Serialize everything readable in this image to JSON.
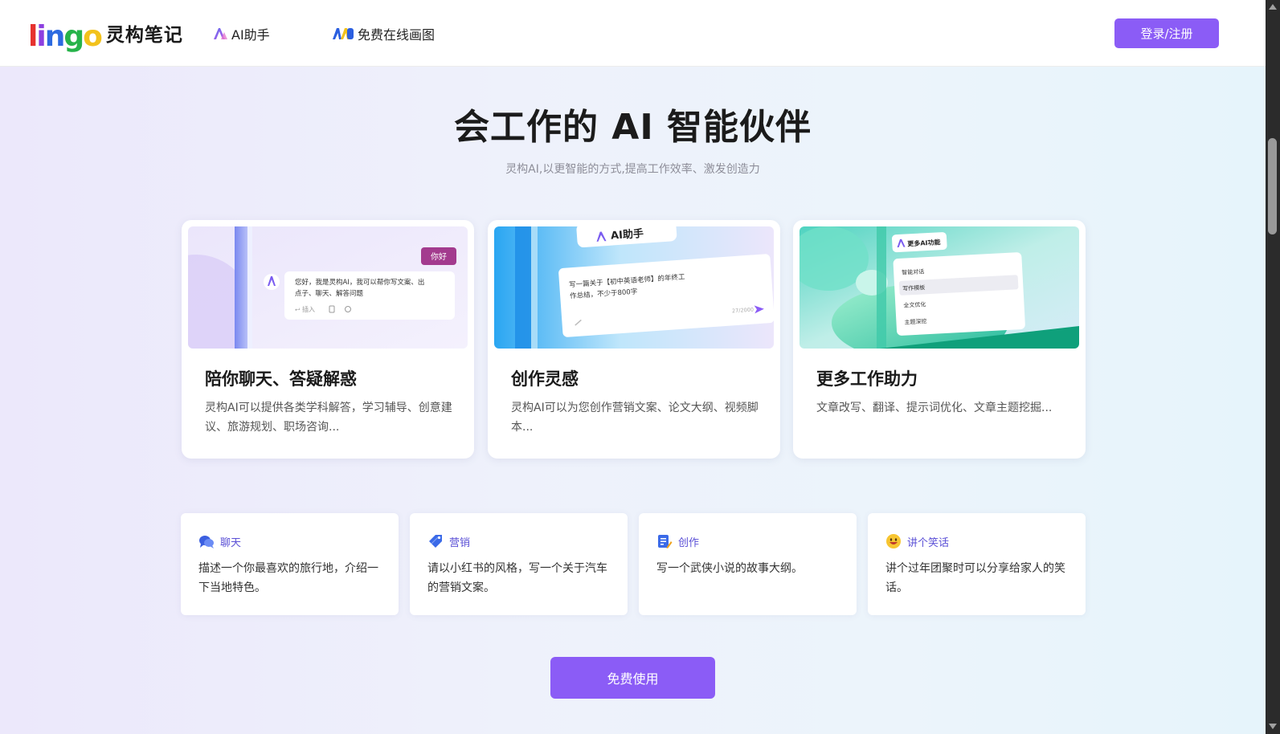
{
  "header": {
    "logo_mark": [
      "l",
      "i",
      "n",
      "g",
      "o"
    ],
    "logo_text": "灵构笔记",
    "nav": {
      "ai_assistant": "AI助手",
      "free_drawing": "免费在线画图"
    },
    "login_label": "登录/注册"
  },
  "hero": {
    "title": "会工作的 AI 智能伙伴",
    "subtitle": "灵构AI,以更智能的方式,提高工作效率、激发创造力"
  },
  "features": [
    {
      "title": "陪你聊天、答疑解惑",
      "desc": "灵构AI可以提供各类学科解答，学习辅导、创意建议、旅游规划、职场咨询...",
      "mock": {
        "greeting": "你好",
        "reply": "您好，我是灵构AI，我可以帮你写文案、出点子、聊天、解答问题",
        "insert": "插入"
      }
    },
    {
      "title": "创作灵感",
      "desc": "灵构AI可以为您创作营销文案、论文大纲、视频脚本...",
      "mock": {
        "badge": "AI助手",
        "prompt": "写一篇关于【初中英语老师】的年终工作总结，不少于800字",
        "counter": "27/2000"
      }
    },
    {
      "title": "更多工作助力",
      "desc": "文章改写、翻译、提示词优化、文章主题挖掘...",
      "mock": {
        "badge": "更多AI功能",
        "items": [
          "智能对话",
          "写作模板",
          "全文优化",
          "主题深挖"
        ]
      }
    }
  ],
  "prompts": [
    {
      "icon": "chat-bubble-icon",
      "tag": "聊天",
      "text": "描述一个你最喜欢的旅行地，介绍一下当地特色。"
    },
    {
      "icon": "price-tag-icon",
      "tag": "营销",
      "text": "请以小红书的风格，写一个关于汽车的营销文案。"
    },
    {
      "icon": "document-pen-icon",
      "tag": "创作",
      "text": "写一个武侠小说的故事大纲。"
    },
    {
      "icon": "smiley-face-icon",
      "tag": "讲个笑话",
      "text": "讲个过年团聚时可以分享给家人的笑话。"
    }
  ],
  "cta_label": "免费使用",
  "colors": {
    "accent": "#8b5cf6",
    "tag_text": "#5b50d6",
    "heading": "#1b1b1b"
  }
}
